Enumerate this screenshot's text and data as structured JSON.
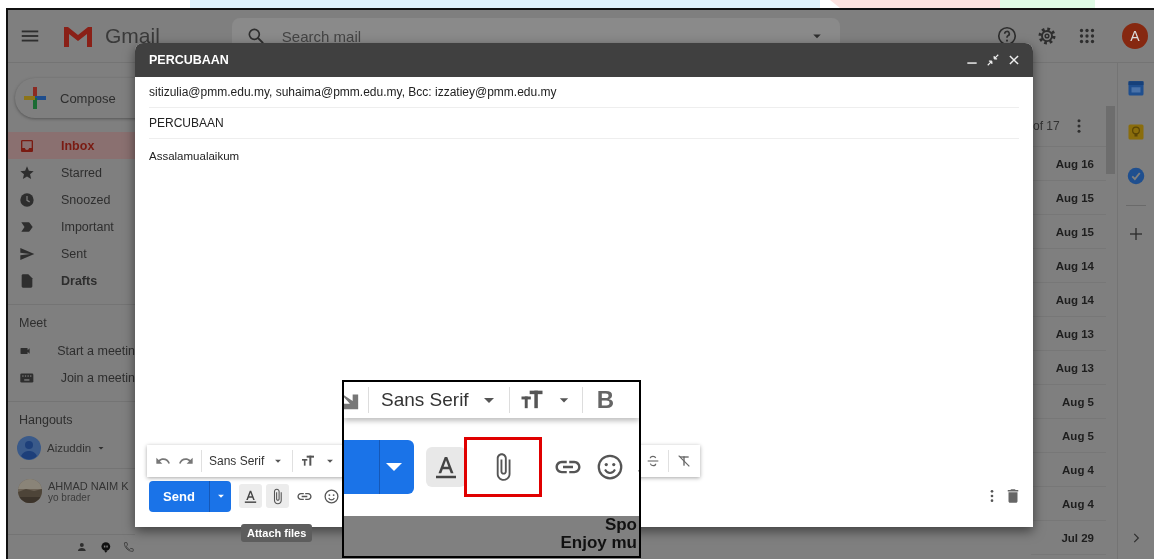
{
  "header": {
    "app_name": "Gmail",
    "search": {
      "placeholder": "Search mail"
    },
    "avatar": "A"
  },
  "sidebar": {
    "compose": "Compose",
    "items": [
      {
        "kind": "inbox",
        "label": "Inbox",
        "selected": true,
        "bold": true
      },
      {
        "kind": "star",
        "label": "Starred",
        "selected": false,
        "bold": false
      },
      {
        "kind": "clock",
        "label": "Snoozed",
        "selected": false,
        "bold": false
      },
      {
        "kind": "label",
        "label": "Important",
        "selected": false,
        "bold": false
      },
      {
        "kind": "send",
        "label": "Sent",
        "selected": false,
        "bold": false
      },
      {
        "kind": "file",
        "label": "Drafts",
        "selected": false,
        "bold": true
      }
    ],
    "meet": {
      "title": "Meet",
      "items": [
        {
          "kind": "video",
          "label": "Start a meetin"
        },
        {
          "kind": "keyboard",
          "label": "Join a meetin"
        }
      ]
    },
    "hangouts": {
      "title": "Hangouts",
      "user": "Aizuddin",
      "contacts": [
        {
          "name": "AHMAD NAIM K",
          "message": "yo brader"
        }
      ]
    }
  },
  "message_list": {
    "pagination": "of 17",
    "dates": [
      "Aug 16",
      "Aug 15",
      "Aug 15",
      "Aug 14",
      "Aug 14",
      "Aug 13",
      "Aug 13",
      "Aug 5",
      "Aug 5",
      "Aug 4",
      "Aug 4",
      "Jul 29"
    ]
  },
  "compose": {
    "title": "PERCUBAAN",
    "recipients": "sitizulia@pmm.edu.my, suhaima@pmm.edu.my, Bcc: izzatiey@pmm.edu.my",
    "subject": "PERCUBAAN",
    "body": "Assalamualaikum",
    "font": "Sans Serif",
    "send": "Send",
    "tools": [
      {
        "kind": "text-format",
        "highlighted": true
      },
      {
        "kind": "attach",
        "highlighted": true
      },
      {
        "kind": "link",
        "highlighted": false
      },
      {
        "kind": "emoji",
        "highlighted": false
      }
    ],
    "tooltip": "Attach files"
  },
  "inset": {
    "font": "Sans Serif",
    "bold_button": "B",
    "tools": [
      {
        "kind": "text-format",
        "highlighted": true,
        "boxed": false
      },
      {
        "kind": "attach",
        "highlighted": false,
        "boxed": true
      },
      {
        "kind": "link",
        "highlighted": false,
        "boxed": false
      },
      {
        "kind": "emoji",
        "highlighted": false,
        "boxed": false
      },
      {
        "kind": "drive",
        "highlighted": false,
        "boxed": false
      }
    ],
    "list_fragments": [
      "Spo",
      "Enjoy mu"
    ]
  }
}
